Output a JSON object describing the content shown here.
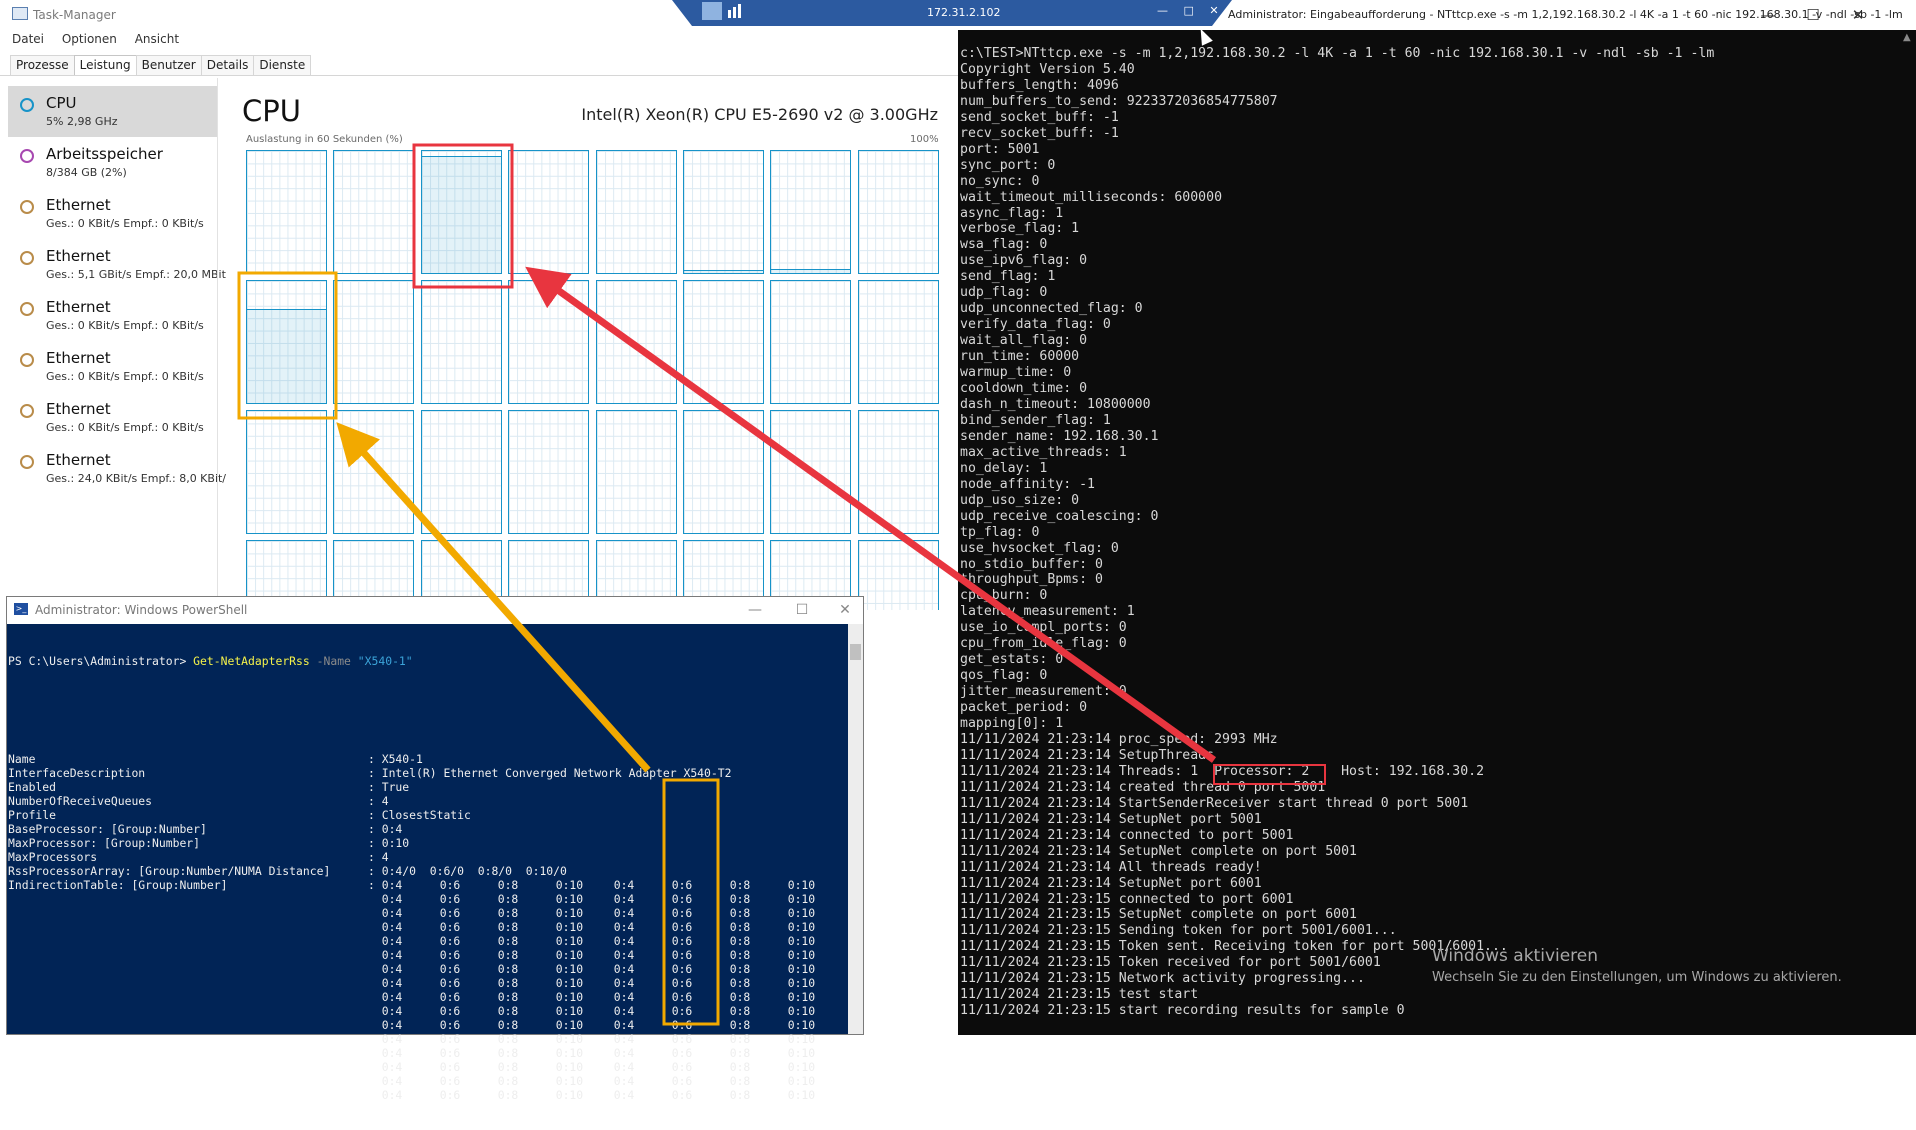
{
  "task_manager": {
    "title": "Task-Manager",
    "menu": [
      "Datei",
      "Optionen",
      "Ansicht"
    ],
    "tabs": [
      "Prozesse",
      "Leistung",
      "Benutzer",
      "Details",
      "Dienste"
    ],
    "active_tab": "Leistung",
    "sidebar": [
      {
        "name": "CPU",
        "sub": "5% 2,98 GHz",
        "color": "#1793c8"
      },
      {
        "name": "Arbeitsspeicher",
        "sub": "8/384 GB (2%)",
        "color": "#a748b0"
      },
      {
        "name": "Ethernet",
        "sub": "Ges.: 0 KBit/s Empf.: 0 KBit/s",
        "color": "#b98c4a"
      },
      {
        "name": "Ethernet",
        "sub": "Ges.: 5,1 GBit/s Empf.: 20,0 MBit",
        "color": "#b98c4a"
      },
      {
        "name": "Ethernet",
        "sub": "Ges.: 0 KBit/s Empf.: 0 KBit/s",
        "color": "#b98c4a"
      },
      {
        "name": "Ethernet",
        "sub": "Ges.: 0 KBit/s Empf.: 0 KBit/s",
        "color": "#b98c4a"
      },
      {
        "name": "Ethernet",
        "sub": "Ges.: 0 KBit/s Empf.: 0 KBit/s",
        "color": "#b98c4a"
      },
      {
        "name": "Ethernet",
        "sub": "Ges.: 24,0 KBit/s Empf.: 8,0 KBit/",
        "color": "#b98c4a"
      }
    ],
    "cpu_panel": {
      "title": "CPU",
      "model": "Intel(R) Xeon(R) CPU E5-2690 v2 @ 3.00GHz",
      "graph_label": "Auslastung in 60 Sekunden (%)",
      "graph_max": "100%",
      "core_loads": [
        0,
        0,
        1,
        0,
        0,
        0.02,
        0.03,
        0,
        0.8,
        0,
        0,
        0,
        0,
        0,
        0,
        0,
        0,
        0,
        0,
        0,
        0,
        0,
        0,
        0,
        0,
        0,
        0,
        0,
        0,
        0,
        0,
        0
      ]
    }
  },
  "rdp_bar": {
    "ip": "172.31.2.102"
  },
  "console": {
    "title": "Administrator: Eingabeaufforderung - NTttcp.exe  -s -m 1,2,192.168.30.2 -l 4K -a 1 -t 60 -nic 192.168.30.1 -v -ndl -sb -1 -lm",
    "lines": [
      "c:\\TEST>NTttcp.exe -s -m 1,2,192.168.30.2 -l 4K -a 1 -t 60 -nic 192.168.30.1 -v -ndl -sb -1 -lm",
      "Copyright Version 5.40",
      "buffers_length: 4096",
      "num_buffers_to_send: 9223372036854775807",
      "send_socket_buff: -1",
      "recv_socket_buff: -1",
      "port: 5001",
      "sync_port: 0",
      "no_sync: 0",
      "wait_timeout_milliseconds: 600000",
      "async_flag: 1",
      "verbose_flag: 1",
      "wsa_flag: 0",
      "use_ipv6_flag: 0",
      "send_flag: 1",
      "udp_flag: 0",
      "udp_unconnected_flag: 0",
      "verify_data_flag: 0",
      "wait_all_flag: 0",
      "run_time: 60000",
      "warmup_time: 0",
      "cooldown_time: 0",
      "dash_n_timeout: 10800000",
      "bind_sender_flag: 1",
      "sender_name: 192.168.30.1",
      "max_active_threads: 1",
      "no_delay: 1",
      "node_affinity: -1",
      "udp_uso_size: 0",
      "udp_receive_coalescing: 0",
      "tp_flag: 0",
      "use_hvsocket_flag: 0",
      "no_stdio_buffer: 0",
      "throughput_Bpms: 0",
      "cpu_burn: 0",
      "latency_measurement: 1",
      "use_io_compl_ports: 0",
      "cpu_from_idle_flag: 0",
      "get_estats: 0",
      "qos_flag: 0",
      "jitter_measurement: 0",
      "packet_period: 0",
      "mapping[0]: 1",
      "11/11/2024 21:23:14 proc_speed: 2993 MHz",
      "11/11/2024 21:23:14 SetupThreads",
      "11/11/2024 21:23:14 Threads: 1  Processor: 2    Host: 192.168.30.2",
      "11/11/2024 21:23:14 created thread 0 port 5001",
      "11/11/2024 21:23:14 StartSenderReceiver start thread 0 port 5001",
      "11/11/2024 21:23:14 SetupNet port 5001",
      "11/11/2024 21:23:14 connected to port 5001",
      "11/11/2024 21:23:14 SetupNet complete on port 5001",
      "11/11/2024 21:23:14 All threads ready!",
      "11/11/2024 21:23:14 SetupNet port 6001",
      "11/11/2024 21:23:15 connected to port 6001",
      "11/11/2024 21:23:15 SetupNet complete on port 6001",
      "11/11/2024 21:23:15 Sending token for port 5001/6001...",
      "11/11/2024 21:23:15 Token sent. Receiving token for port 5001/6001...",
      "11/11/2024 21:23:15 Token received for port 5001/6001",
      "11/11/2024 21:23:15 Network activity progressing...",
      "11/11/2024 21:23:15 test start",
      "11/11/2024 21:23:15 start recording results for sample 0"
    ],
    "highlight_text": "Processor: 2",
    "watermark_title": "Windows aktivieren",
    "watermark_sub": "Wechseln Sie zu den Einstellungen, um Windows zu aktivieren."
  },
  "powershell": {
    "title": "Administrator: Windows PowerShell",
    "prompt": "PS C:\\Users\\Administrator>",
    "command": "Get-NetAdapterRss",
    "param": "-Name",
    "arg": "\"X540-1\"",
    "properties": [
      {
        "key": "Name",
        "value": "X540-1"
      },
      {
        "key": "InterfaceDescription",
        "value": "Intel(R) Ethernet Converged Network Adapter X540-T2"
      },
      {
        "key": "Enabled",
        "value": "True"
      },
      {
        "key": "NumberOfReceiveQueues",
        "value": "4"
      },
      {
        "key": "Profile",
        "value": "ClosestStatic"
      },
      {
        "key": "BaseProcessor: [Group:Number]",
        "value": "0:4"
      },
      {
        "key": "MaxProcessor: [Group:Number]",
        "value": "0:10"
      },
      {
        "key": "MaxProcessors",
        "value": "4"
      },
      {
        "key": "RssProcessorArray: [Group:Number/NUMA Distance]",
        "value": "0:4/0  0:6/0  0:8/0  0:10/0"
      },
      {
        "key": "IndirectionTable: [Group:Number]",
        "value": ""
      }
    ],
    "indirection_row": [
      "0:4",
      "0:6",
      "0:8",
      "0:10",
      "0:4",
      "0:6",
      "0:8",
      "0:10"
    ],
    "indirection_row_count": 16
  },
  "colors": {
    "annotation_red": "#e8353f",
    "annotation_orange": "#f2a900"
  }
}
